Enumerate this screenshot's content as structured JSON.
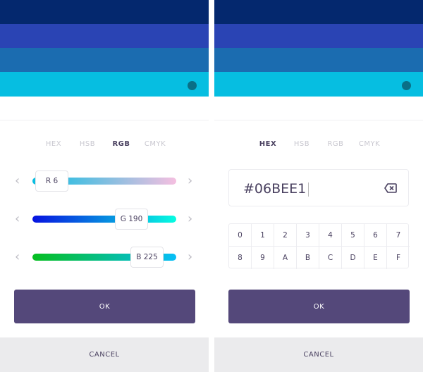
{
  "colors": {
    "stripe1": "#04286e",
    "stripe2": "#2a44b4",
    "stripe3": "#1b6cb0",
    "stripe4": "#06bee1",
    "selected_dot": "#0a6f86",
    "accent": "#54487a"
  },
  "tabs": [
    "HEX",
    "HSB",
    "RGB",
    "CMYK"
  ],
  "rgb_panel": {
    "active_tab": "RGB",
    "sliders": [
      {
        "label": "R 6",
        "value": 6,
        "max": 255
      },
      {
        "label": "G 190",
        "value": 190,
        "max": 255
      },
      {
        "label": "B 225",
        "value": 225,
        "max": 255
      }
    ],
    "ok": "OK",
    "cancel": "CANCEL"
  },
  "hex_panel": {
    "active_tab": "HEX",
    "hex_value": "#06BEE1",
    "keys": [
      "0",
      "1",
      "2",
      "3",
      "4",
      "5",
      "6",
      "7",
      "8",
      "9",
      "A",
      "B",
      "C",
      "D",
      "E",
      "F"
    ],
    "ok": "OK",
    "cancel": "CANCEL"
  }
}
